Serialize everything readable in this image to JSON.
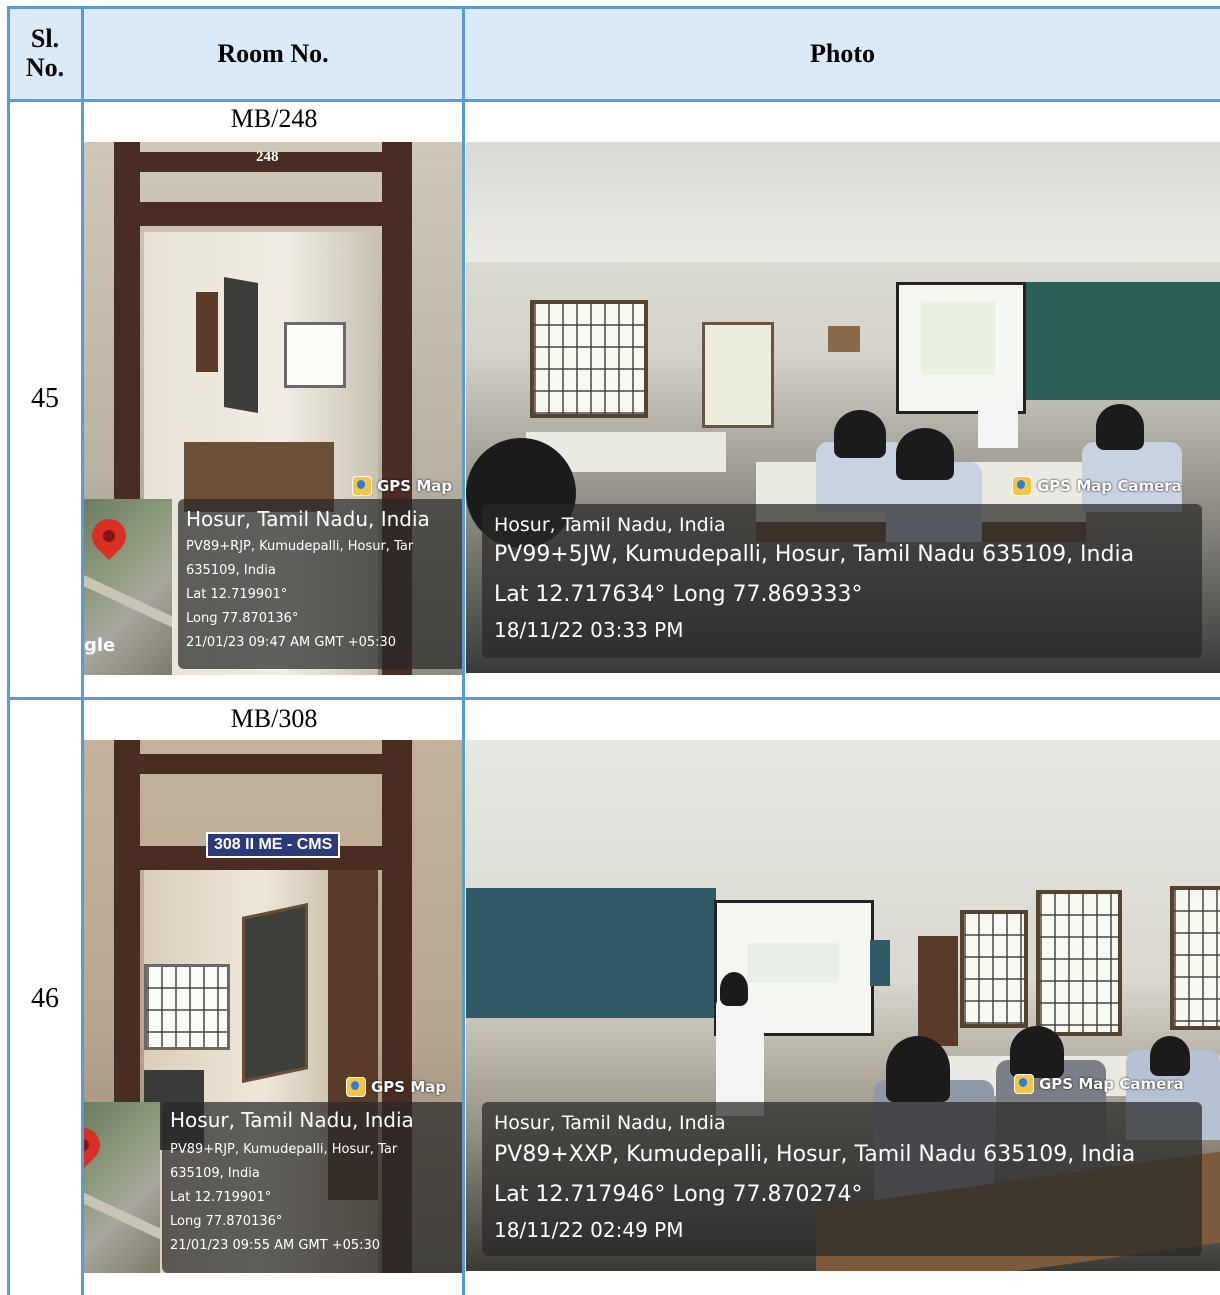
{
  "header": {
    "sl_no": "Sl. No.",
    "room_no": "Room No.",
    "photo": "Photo"
  },
  "rows": [
    {
      "sl_no": "45",
      "room": "MB/248",
      "door_number": "248",
      "door_photo": {
        "badge": "GPS Map",
        "city": "Hosur, Tamil Nadu, India",
        "address": "PV89+RJP, Kumudepalli, Hosur, Tar",
        "address2": "635109, India",
        "lat": "Lat 12.719901°",
        "long": "Long 77.870136°",
        "datetime": "21/01/23 09:47 AM GMT +05:30",
        "map_label": "gle"
      },
      "class_photo": {
        "badge": "GPS Map Camera",
        "city": "Hosur, Tamil Nadu, India",
        "address": "PV99+5JW, Kumudepalli, Hosur, Tamil Nadu 635109, India",
        "latlong": "Lat 12.717634° Long 77.869333°",
        "datetime": "18/11/22 03:33 PM"
      }
    },
    {
      "sl_no": "46",
      "room": "MB/308",
      "door_plate": "308 II ME - CMS",
      "door_photo": {
        "badge": "GPS Map",
        "city": "Hosur, Tamil Nadu, India",
        "address": "PV89+RJP, Kumudepalli, Hosur, Tar",
        "address2": "635109, India",
        "lat": "Lat 12.719901°",
        "long": "Long 77.870136°",
        "datetime": "21/01/23 09:55 AM GMT +05:30"
      },
      "class_photo": {
        "badge": "GPS Map Camera",
        "city": "Hosur, Tamil Nadu, India",
        "address": "PV89+XXP, Kumudepalli, Hosur, Tamil Nadu 635109, India",
        "latlong": "Lat 12.717946° Long 77.870274°",
        "datetime": "18/11/22 02:49 PM"
      }
    }
  ]
}
